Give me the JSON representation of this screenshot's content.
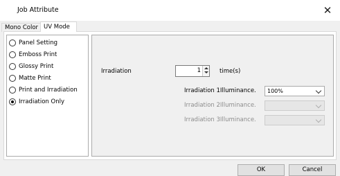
{
  "window": {
    "title": "Job Attribute",
    "close_glyph": "✕"
  },
  "tabs": [
    {
      "label": "Mono Color",
      "active": false
    },
    {
      "label": "UV Mode",
      "active": true
    }
  ],
  "modes": [
    {
      "label": "Panel Setting",
      "checked": false
    },
    {
      "label": "Emboss Print",
      "checked": false
    },
    {
      "label": "Glossy Print",
      "checked": false
    },
    {
      "label": "Matte Print",
      "checked": false
    },
    {
      "label": "Print and Irradiation",
      "checked": false
    },
    {
      "label": "Irradiation Only",
      "checked": true
    }
  ],
  "irradiation": {
    "label": "Irradiation",
    "count_value": "1",
    "unit": "time(s)",
    "levels": [
      {
        "label": "Irradiation 1Illuminance.",
        "value": "100%",
        "enabled": true
      },
      {
        "label": "Irradiation 2Illuminance.",
        "value": "",
        "enabled": false
      },
      {
        "label": "Irradiation 3Illuminance.",
        "value": "",
        "enabled": false
      }
    ]
  },
  "buttons": {
    "ok": "OK",
    "cancel": "Cancel"
  }
}
